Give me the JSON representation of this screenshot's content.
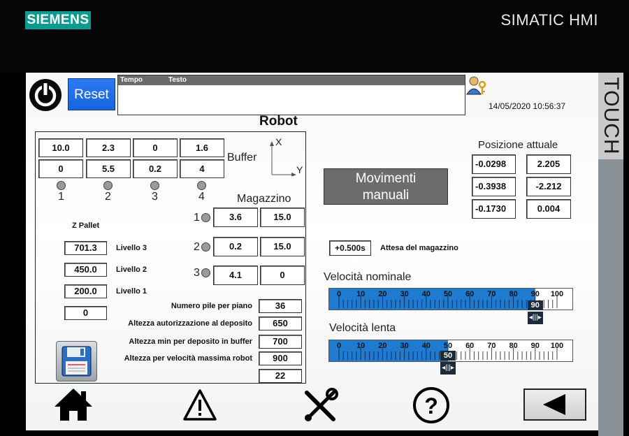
{
  "bezel": {
    "brand": "SIEMENS",
    "product": "SIMATIC HMI",
    "side_label": "TOUCH"
  },
  "header": {
    "reset_label": "Reset",
    "alarm_col_time": "Tempo",
    "alarm_col_text": "Testo",
    "datetime": "14/05/2020 10:56:37"
  },
  "page_title": "Robot",
  "buffer": {
    "title": "Buffer",
    "row1": [
      "10.0",
      "2.3",
      "0",
      "1.6"
    ],
    "row2": [
      "0",
      "5.5",
      "0.2",
      "4"
    ],
    "indices": [
      "1",
      "2",
      "3",
      "4"
    ],
    "axis_x": "X",
    "axis_y": "Y"
  },
  "magazzino": {
    "title": "Magazzino",
    "rows": [
      {
        "index": "1",
        "a": "3.6",
        "b": "15.0"
      },
      {
        "index": "2",
        "a": "0.2",
        "b": "15.0"
      },
      {
        "index": "3",
        "a": "4.1",
        "b": "0"
      }
    ]
  },
  "z_pallet": {
    "title": "Z Pallet",
    "levels": [
      {
        "value": "701.3",
        "label": "Livello 3"
      },
      {
        "value": "450.0",
        "label": "Livello 2"
      },
      {
        "value": "200.0",
        "label": "Livello 1"
      }
    ],
    "extra_value": "0"
  },
  "params": [
    {
      "label": "Numero pile per piano",
      "value": "36"
    },
    {
      "label": "Altezza autorizzazione al deposito",
      "value": "650"
    },
    {
      "label": "Altezza min per deposito in buffer",
      "value": "700"
    },
    {
      "label": "Altezza per velocità massima robot",
      "value": "900"
    },
    {
      "label": "",
      "value": "22"
    }
  ],
  "movimenti_label_1": "Movimenti",
  "movimenti_label_2": "manuali",
  "posizione": {
    "title": "Posizione attuale",
    "rows": [
      [
        "-0.0298",
        "2.205"
      ],
      [
        "-0.3938",
        "-2.212"
      ],
      [
        "-0.1730",
        "0.004"
      ]
    ]
  },
  "attesa": {
    "value": "+0.500s",
    "label": "Attesa del magazzino"
  },
  "vel_nominale": {
    "label": "Velocità nominale",
    "value": 90,
    "value_text": "90",
    "min": 0,
    "max": 100,
    "ticks": [
      "0",
      "10",
      "20",
      "30",
      "40",
      "50",
      "60",
      "70",
      "80",
      "90",
      "100"
    ]
  },
  "vel_lenta": {
    "label": "Velocità lenta",
    "value": 50,
    "value_text": "50",
    "min": 0,
    "max": 100,
    "ticks": [
      "0",
      "10",
      "20",
      "30",
      "40",
      "50",
      "60",
      "70",
      "80",
      "90",
      "100"
    ]
  },
  "nav_icons": [
    "home-icon",
    "warning-icon",
    "tools-icon",
    "help-icon",
    "back-arrow-icon"
  ],
  "colors": {
    "brand": "#0f9a8f",
    "accent": "#1e7bd0",
    "reset_button": "#1565e0"
  }
}
